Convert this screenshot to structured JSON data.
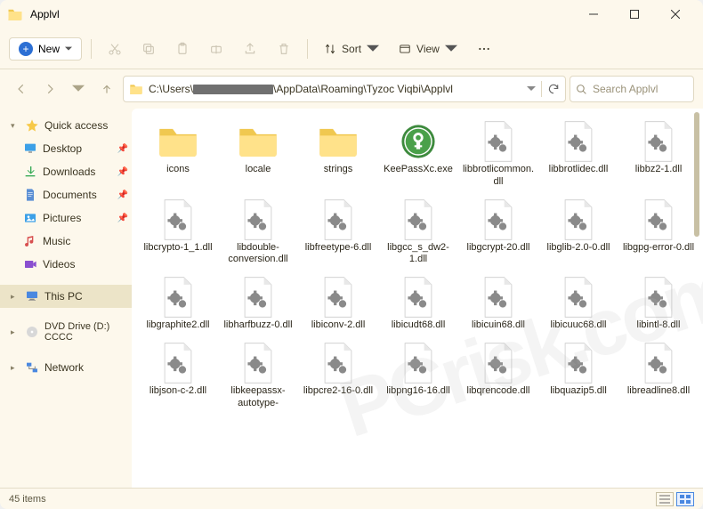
{
  "window": {
    "title": "Applvl"
  },
  "toolbar": {
    "new_label": "New",
    "sort_label": "Sort",
    "view_label": "View"
  },
  "address": {
    "path_prefix": "C:\\Users\\",
    "path_suffix": "\\AppData\\Roaming\\Tyzoc Viqbi\\Applvl"
  },
  "search": {
    "placeholder": "Search Applvl"
  },
  "sidebar": {
    "quick": "Quick access",
    "items": [
      {
        "label": "Desktop"
      },
      {
        "label": "Downloads"
      },
      {
        "label": "Documents"
      },
      {
        "label": "Pictures"
      },
      {
        "label": "Music"
      },
      {
        "label": "Videos"
      }
    ],
    "thispc": "This PC",
    "dvd": "DVD Drive (D:) CCCC",
    "network": "Network"
  },
  "files": [
    {
      "name": "icons",
      "type": "folder"
    },
    {
      "name": "locale",
      "type": "folder"
    },
    {
      "name": "strings",
      "type": "folder"
    },
    {
      "name": "KeePassXc.exe",
      "type": "exe"
    },
    {
      "name": "libbrotlicommon.dll",
      "type": "dll"
    },
    {
      "name": "libbrotlidec.dll",
      "type": "dll"
    },
    {
      "name": "libbz2-1.dll",
      "type": "dll"
    },
    {
      "name": "libcrypto-1_1.dll",
      "type": "dll"
    },
    {
      "name": "libdouble-conversion.dll",
      "type": "dll"
    },
    {
      "name": "libfreetype-6.dll",
      "type": "dll"
    },
    {
      "name": "libgcc_s_dw2-1.dll",
      "type": "dll"
    },
    {
      "name": "libgcrypt-20.dll",
      "type": "dll"
    },
    {
      "name": "libglib-2.0-0.dll",
      "type": "dll"
    },
    {
      "name": "libgpg-error-0.dll",
      "type": "dll"
    },
    {
      "name": "libgraphite2.dll",
      "type": "dll"
    },
    {
      "name": "libharfbuzz-0.dll",
      "type": "dll"
    },
    {
      "name": "libiconv-2.dll",
      "type": "dll"
    },
    {
      "name": "libicudt68.dll",
      "type": "dll"
    },
    {
      "name": "libicuin68.dll",
      "type": "dll"
    },
    {
      "name": "libicuuc68.dll",
      "type": "dll"
    },
    {
      "name": "libintl-8.dll",
      "type": "dll"
    },
    {
      "name": "libjson-c-2.dll",
      "type": "dll"
    },
    {
      "name": "libkeepassx-autotype-windows.dll",
      "type": "dll"
    },
    {
      "name": "libpcre2-16-0.dll",
      "type": "dll"
    },
    {
      "name": "libpng16-16.dll",
      "type": "dll"
    },
    {
      "name": "libqrencode.dll",
      "type": "dll"
    },
    {
      "name": "libquazip5.dll",
      "type": "dll"
    },
    {
      "name": "libreadline8.dll",
      "type": "dll"
    }
  ],
  "status": {
    "count_label": "45 items"
  },
  "colors": {
    "star": "#f7c948",
    "accent": "#2c6fd4",
    "folder1": "#ffe28a",
    "folder2": "#f0c850"
  }
}
